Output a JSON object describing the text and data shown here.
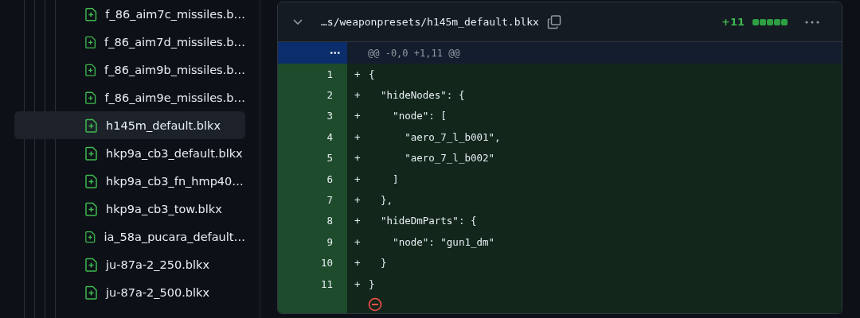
{
  "file_tree": {
    "items": [
      {
        "name": "f_86_aim7c_missiles.b…",
        "selected": false
      },
      {
        "name": "f_86_aim7d_missiles.b…",
        "selected": false
      },
      {
        "name": "f_86_aim9b_missiles.b…",
        "selected": false
      },
      {
        "name": "f_86_aim9e_missiles.b…",
        "selected": false
      },
      {
        "name": "h145m_default.blkx",
        "selected": true
      },
      {
        "name": "hkp9a_cb3_default.blkx",
        "selected": false
      },
      {
        "name": "hkp9a_cb3_fn_hmp40…",
        "selected": false
      },
      {
        "name": "hkp9a_cb3_tow.blkx",
        "selected": false
      },
      {
        "name": "ia_58a_pucara_default…",
        "selected": false
      },
      {
        "name": "ju-87a-2_250.blkx",
        "selected": false
      },
      {
        "name": "ju-87a-2_500.blkx",
        "selected": false
      }
    ]
  },
  "diff": {
    "expanded": true,
    "path": "…s/weaponpresets/h145m_default.blkx",
    "additions": "+11",
    "diffstat": [
      {
        "kind": "added"
      },
      {
        "kind": "added"
      },
      {
        "kind": "added"
      },
      {
        "kind": "added"
      },
      {
        "kind": "added"
      }
    ],
    "expander": "•••",
    "hunk_header": "@@ -0,0 +1,11 @@",
    "lines": [
      {
        "number": "1",
        "marker": "+",
        "code": "{"
      },
      {
        "number": "2",
        "marker": "+",
        "code": "  \"hideNodes\": {"
      },
      {
        "number": "3",
        "marker": "+",
        "code": "    \"node\": ["
      },
      {
        "number": "4",
        "marker": "+",
        "code": "      \"aero_7_l_b001\","
      },
      {
        "number": "5",
        "marker": "+",
        "code": "      \"aero_7_l_b002\""
      },
      {
        "number": "6",
        "marker": "+",
        "code": "    ]"
      },
      {
        "number": "7",
        "marker": "+",
        "code": "  },"
      },
      {
        "number": "8",
        "marker": "+",
        "code": "  \"hideDmParts\": {"
      },
      {
        "number": "9",
        "marker": "+",
        "code": "    \"node\": \"gun1_dm\""
      },
      {
        "number": "10",
        "marker": "+",
        "code": "  }"
      },
      {
        "number": "11",
        "marker": "+",
        "code": "}"
      }
    ]
  }
}
